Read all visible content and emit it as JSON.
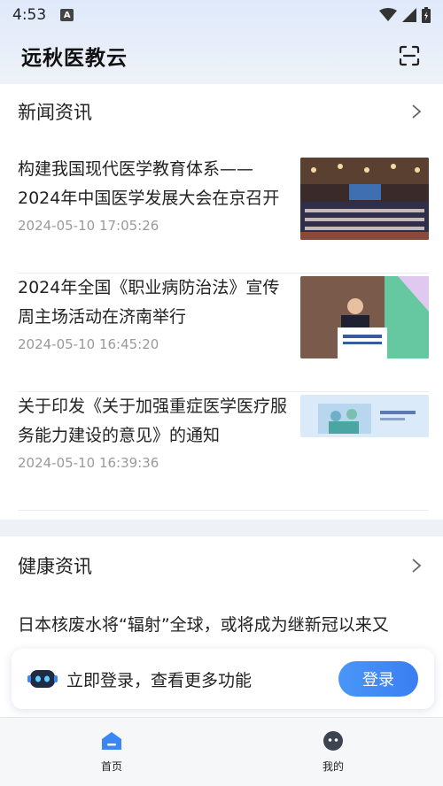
{
  "status_bar": {
    "time": "4:53",
    "notification_letter": "A"
  },
  "header": {
    "title": "远秋医教云"
  },
  "news_section": {
    "title": "新闻资讯",
    "items": [
      {
        "title": "构建我国现代医学教育体系——2024年中国医学发展大会在京召开",
        "time": "2024-05-10 17:05:26"
      },
      {
        "title": "2024年全国《职业病防治法》宣传周主场活动在济南举行",
        "time": "2024-05-10 16:45:20"
      },
      {
        "title": "关于印发《关于加强重症医学医疗服务能力建设的意见》的通知",
        "time": "2024-05-10 16:39:36"
      }
    ]
  },
  "health_section": {
    "title": "健康资讯",
    "first_item": "日本核废水将“辐射”全球，或将成为继新冠以来又"
  },
  "login_banner": {
    "text": "立即登录，查看更多功能",
    "button": "登录"
  },
  "tabbar": {
    "home": "首页",
    "mine": "我的"
  },
  "colors": {
    "accent": "#3a86f5",
    "background": "#eef1f6"
  }
}
